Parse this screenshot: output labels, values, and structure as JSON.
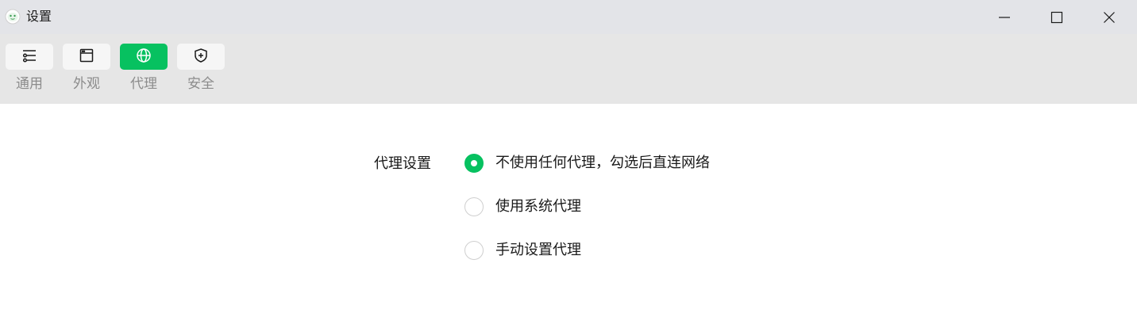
{
  "window": {
    "title": "设置",
    "controls": {
      "minimize_icon": "minimize-icon",
      "maximize_icon": "maximize-icon",
      "close_icon": "close-icon"
    }
  },
  "toolbar": {
    "items": [
      {
        "label": "通用",
        "icon": "sliders-icon",
        "active": false
      },
      {
        "label": "外观",
        "icon": "window-icon",
        "active": false
      },
      {
        "label": "代理",
        "icon": "globe-icon",
        "active": true
      },
      {
        "label": "安全",
        "icon": "shield-plus-icon",
        "active": false
      }
    ]
  },
  "proxy": {
    "section_label": "代理设置",
    "options": [
      {
        "label": "不使用任何代理，勾选后直连网络",
        "checked": true
      },
      {
        "label": "使用系统代理",
        "checked": false
      },
      {
        "label": "手动设置代理",
        "checked": false
      }
    ]
  },
  "colors": {
    "accent": "#07c160",
    "titlebar_bg": "#e3e4e8",
    "toolbar_bg": "#e6e6e6",
    "muted_text": "#8c8c8c"
  }
}
